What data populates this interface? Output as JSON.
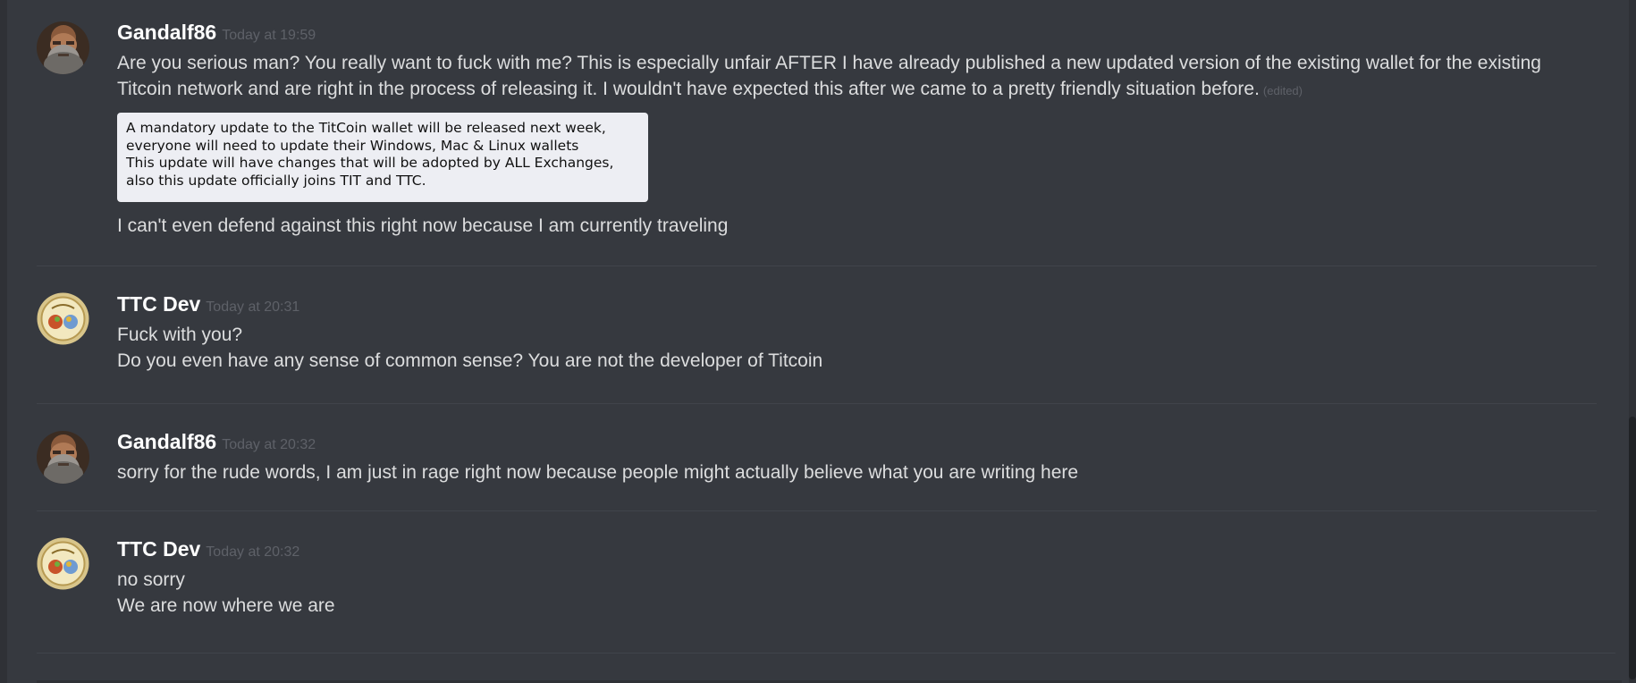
{
  "messages": [
    {
      "author": "Gandalf86",
      "timestamp": "Today at 19:59",
      "avatar": "bearded-man-avatar",
      "lines": [
        "Are you serious man? You really want to fuck with me? This is especially unfair AFTER I have already published a new updated version of the existing wallet for the existing",
        "Titcoin network and are right in the process of releasing it. I wouldn't have expected this after we came to a pretty friendly situation before."
      ],
      "edited_label": "(edited)",
      "embed_lines": [
        "A mandatory update to the TitCoin wallet will be released next week,",
        "everyone will need to update their Windows, Mac & Linux wallets",
        "This update will have changes that will be adopted by ALL Exchanges,",
        "also this update officially joins TIT and TTC."
      ],
      "after_embed": "I can't even defend against this right now because I am currently traveling"
    },
    {
      "author": "TTC Dev",
      "timestamp": "Today at 20:31",
      "avatar": "ttc-coin-avatar",
      "lines": [
        "Fuck with you?",
        "Do you even have any sense of common sense? You are not the developer of Titcoin"
      ]
    },
    {
      "author": "Gandalf86",
      "timestamp": "Today at 20:32",
      "avatar": "bearded-man-avatar",
      "lines": [
        "sorry for the rude words, I am just in rage right now because people might actually believe what you are writing here"
      ]
    },
    {
      "author": "TTC Dev",
      "timestamp": "Today at 20:32",
      "avatar": "ttc-coin-avatar",
      "lines": [
        "no sorry",
        "We are now where we are"
      ]
    }
  ],
  "colors": {
    "background": "#36393f",
    "username": "#ffffff",
    "message_text": "#dcddde",
    "timestamp": "#5e6168",
    "divider": "#40444b",
    "embed_background": "#edeef3"
  }
}
